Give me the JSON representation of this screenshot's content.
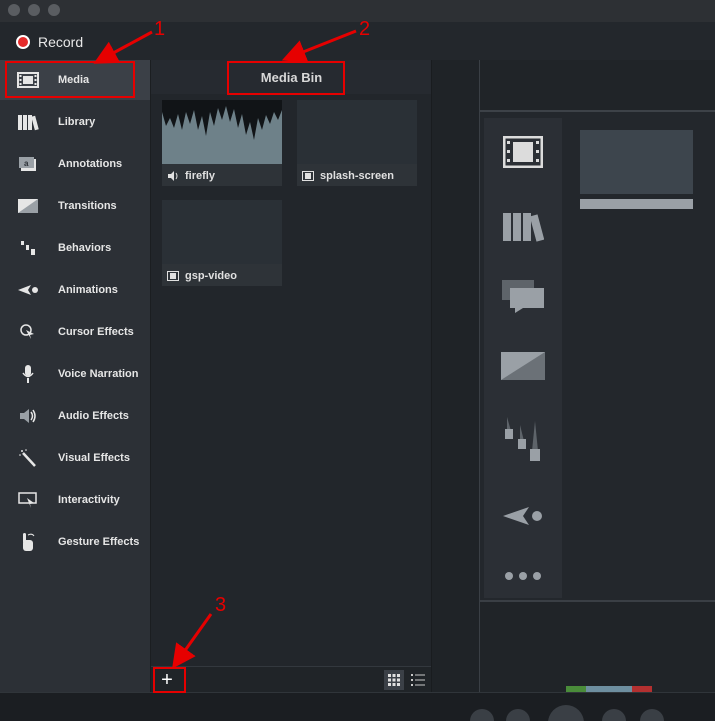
{
  "app": {
    "record_label": "Record"
  },
  "sidebar": {
    "items": [
      {
        "label": "Media",
        "icon": "film-icon"
      },
      {
        "label": "Library",
        "icon": "library-icon"
      },
      {
        "label": "Annotations",
        "icon": "annotation-icon"
      },
      {
        "label": "Transitions",
        "icon": "transition-icon"
      },
      {
        "label": "Behaviors",
        "icon": "behaviors-icon"
      },
      {
        "label": "Animations",
        "icon": "animation-icon"
      },
      {
        "label": "Cursor Effects",
        "icon": "cursor-effects-icon"
      },
      {
        "label": "Voice Narration",
        "icon": "microphone-icon"
      },
      {
        "label": "Audio Effects",
        "icon": "audio-effects-icon"
      },
      {
        "label": "Visual Effects",
        "icon": "magic-wand-icon"
      },
      {
        "label": "Interactivity",
        "icon": "interactivity-icon"
      },
      {
        "label": "Gesture Effects",
        "icon": "gesture-icon"
      }
    ]
  },
  "media_bin": {
    "title": "Media Bin",
    "items": [
      {
        "name": "firefly",
        "kind": "audio"
      },
      {
        "name": "splash-screen",
        "kind": "video"
      },
      {
        "name": "gsp-video",
        "kind": "video"
      }
    ],
    "add_label": "+"
  },
  "annotations": {
    "numbers": [
      "1",
      "2",
      "3"
    ],
    "color": "#e60000"
  },
  "colors": {
    "accent_green": "#8bc34a",
    "record_red": "#e52b2b"
  }
}
